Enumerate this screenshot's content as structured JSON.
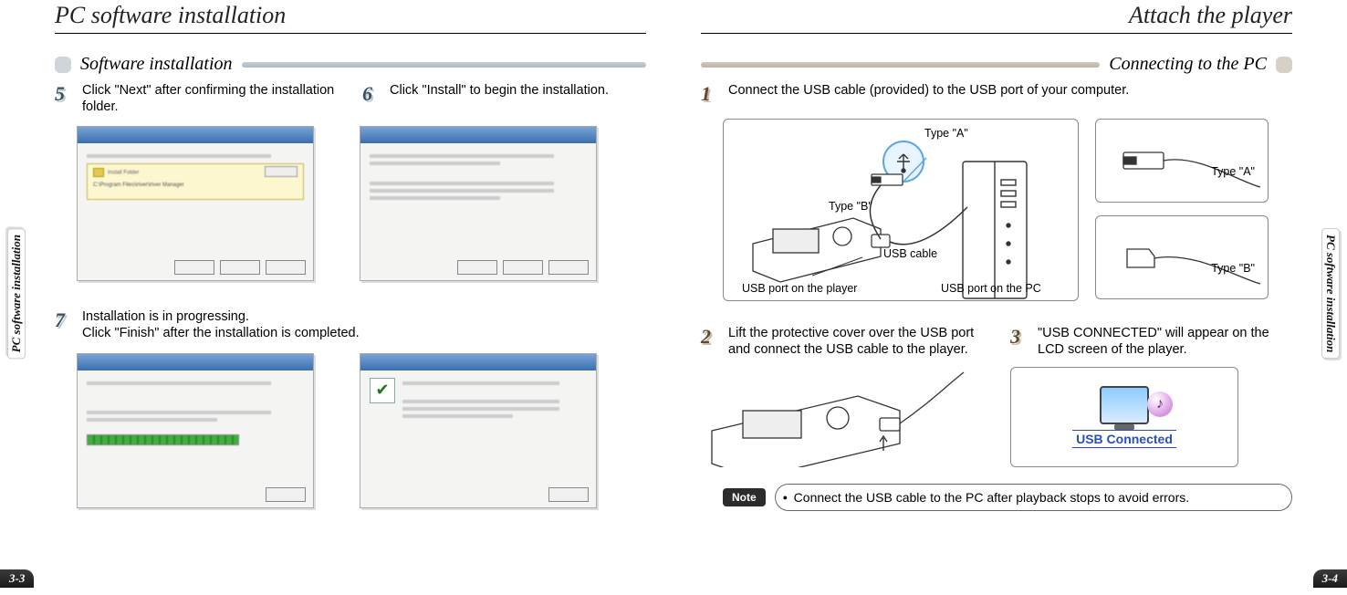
{
  "left": {
    "title": "PC software installation",
    "side_tab": "PC software installation",
    "subheader": "Software installation",
    "page_num": "3-3",
    "steps": {
      "s5": {
        "num": "5",
        "text": "Click \"Next\" after confirming the installation folder."
      },
      "s6": {
        "num": "6",
        "text": "Click \"Install\" to begin the installation."
      },
      "s7_line1": "Installation is in progressing.",
      "s7_line2": "Click \"Finish\" after the installation is completed.",
      "s7_num": "7"
    }
  },
  "right": {
    "title": "Attach the player",
    "side_tab": "PC software installation",
    "subheader": "Connecting to the PC",
    "page_num": "3-4",
    "step1": {
      "num": "1",
      "text": "Connect the USB cable (provided) to the USB port of your computer."
    },
    "step2": {
      "num": "2",
      "text": "Lift the protective cover over the USB port and connect the USB cable to the player."
    },
    "step3": {
      "num": "3",
      "text": "\"USB CONNECTED\" will appear on the LCD screen of the player."
    },
    "labels": {
      "type_a": "Type \"A\"",
      "type_b": "Type \"B\"",
      "usb_cable": "USB cable",
      "port_player": "USB port on the player",
      "port_pc": "USB port on the PC"
    },
    "lcd_caption": "USB Connected",
    "note_badge": "Note",
    "note_text": "Connect the USB cable to the PC after playback stops to avoid errors."
  }
}
